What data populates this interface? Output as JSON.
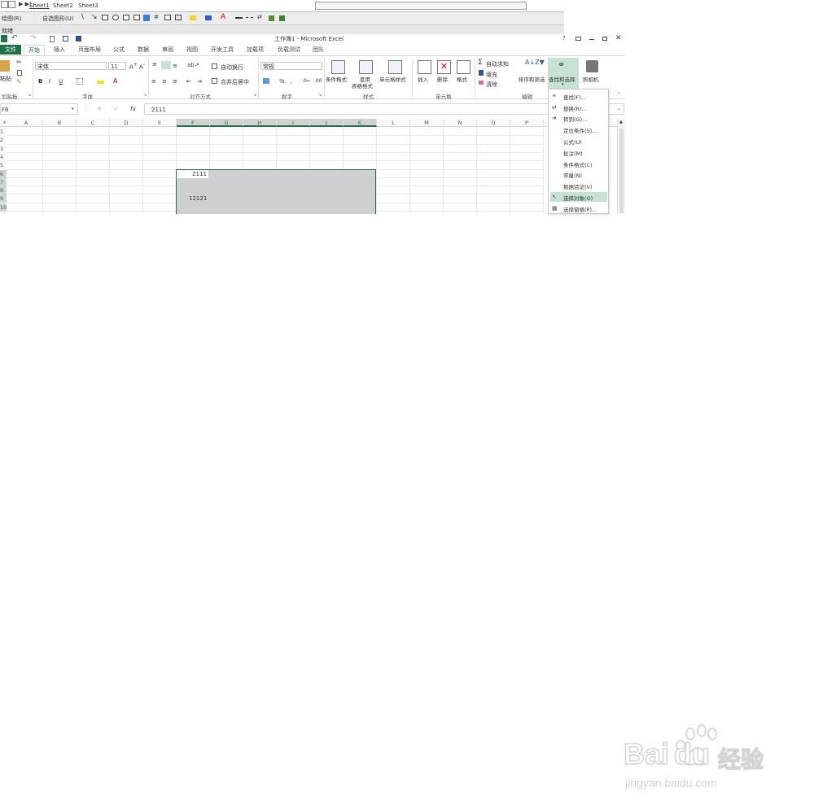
{
  "old_excel": {
    "sheet_tabs": [
      "Sheet1",
      "Sheet2",
      "Sheet3"
    ],
    "draw_label": "绘图(R)",
    "autoshape_label": "自选图形(U)",
    "status": "就绪"
  },
  "window": {
    "title": "工作簿1 - Microsoft Excel",
    "help": "?"
  },
  "ribbon_tabs": [
    "文件",
    "开始",
    "插入",
    "页面布局",
    "公式",
    "数据",
    "审阅",
    "视图",
    "开发工具",
    "加载项",
    "负载测试",
    "团队"
  ],
  "ribbon": {
    "paste": "粘贴",
    "font_name": "宋体",
    "font_size": "11",
    "bold": "B",
    "italic": "I",
    "underline": "U",
    "wrap_text": "自动换行",
    "merge_center": "合并后居中",
    "number_format": "常规",
    "percent": "%",
    "comma": ",",
    "cond_format": "条件格式",
    "table_format_1": "套用",
    "table_format_2": "表格格式",
    "cell_styles": "单元格样式",
    "insert": "插入",
    "delete": "删除",
    "format": "格式",
    "autosum": "自动求和",
    "fill": "填充",
    "clear": "清除",
    "sort_filter": "排序和筛选",
    "find_select": "查找和选择",
    "camera": "照相机",
    "groups": {
      "clipboard": "剪贴板",
      "font": "字体",
      "alignment": "对齐方式",
      "number": "数字",
      "styles": "样式",
      "cells": "单元格",
      "editing": "编辑"
    }
  },
  "formula_bar": {
    "name_box": "F6",
    "fx": "fx",
    "value": "2111"
  },
  "grid": {
    "columns": [
      "A",
      "B",
      "C",
      "D",
      "E",
      "F",
      "G",
      "H",
      "I",
      "J",
      "K",
      "L",
      "M",
      "N",
      "O",
      "P"
    ],
    "rows": [
      "1",
      "2",
      "3",
      "4",
      "5",
      "6",
      "7",
      "8",
      "9",
      "10"
    ],
    "cells": {
      "F6": "2111",
      "F9": "12121"
    },
    "selection": "F6:K10",
    "selection_color": "#cfcfcf",
    "selection_border": "#217346"
  },
  "find_menu": {
    "items": [
      {
        "label": "查找(F)...",
        "icon": "binoculars-icon"
      },
      {
        "label": "替换(R)...",
        "icon": "replace-icon"
      },
      {
        "label": "转到(G)...",
        "icon": "arrow-right-icon"
      },
      {
        "label": "定位条件(S)...",
        "icon": ""
      },
      {
        "label": "公式(U)",
        "icon": ""
      },
      {
        "label": "批注(M)",
        "icon": ""
      },
      {
        "label": "条件格式(C)",
        "icon": ""
      },
      {
        "label": "常量(N)",
        "icon": ""
      },
      {
        "label": "数据验证(V)",
        "icon": ""
      },
      {
        "label": "选择对象(O)",
        "icon": "cursor-icon"
      },
      {
        "label": "选择窗格(P)...",
        "icon": "pane-icon"
      }
    ],
    "highlighted_index": 9
  },
  "watermark": {
    "brand_latin": "Bai",
    "brand_latin_2": "du",
    "brand_cn": "经验",
    "url": "jingyan.baidu.com"
  },
  "colors": {
    "excel_green": "#217346",
    "file_tab": "#217346",
    "active_button_bg": "#c6e2d3"
  }
}
